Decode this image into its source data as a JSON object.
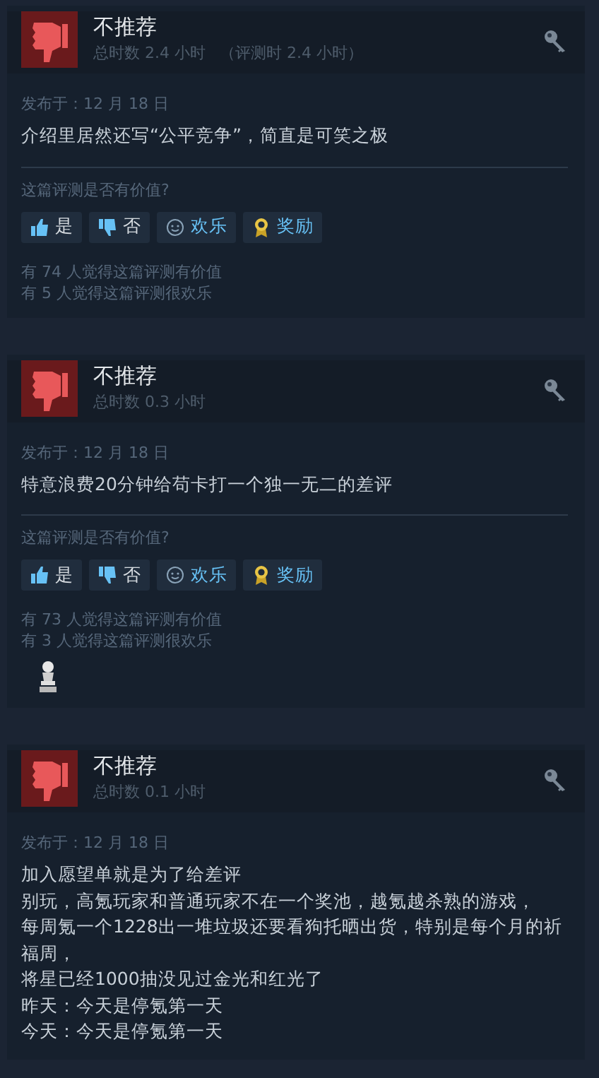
{
  "reviews": [
    {
      "verdict": "不推荐",
      "playtime": "总时数 2.4 小时",
      "playtime_at_review": "（评测时 2.4 小时）",
      "posted": "发布于：12 月 18 日",
      "body": [
        "介绍里居然还写“公平竞争”，简直是可笑之极"
      ],
      "question": "这篇评测是否有价值?",
      "buttons": [
        {
          "kind": "yes",
          "label": "是"
        },
        {
          "kind": "no",
          "label": "否"
        },
        {
          "kind": "funny",
          "label": "欢乐"
        },
        {
          "kind": "award",
          "label": "奖励"
        }
      ],
      "stats": [
        "有 74 人觉得这篇评测有价值",
        "有 5 人觉得这篇评测很欢乐"
      ]
    },
    {
      "verdict": "不推荐",
      "playtime": "总时数 0.3 小时",
      "posted": "发布于：12 月 18 日",
      "body": [
        "特意浪费20分钟给苟卡打一个独一无二的差评"
      ],
      "question": "这篇评测是否有价值?",
      "buttons": [
        {
          "kind": "yes",
          "label": "是"
        },
        {
          "kind": "no",
          "label": "否"
        },
        {
          "kind": "funny",
          "label": "欢乐"
        },
        {
          "kind": "award",
          "label": "奖励"
        }
      ],
      "stats": [
        "有 73 人觉得这篇评测有价值",
        "有 3 人觉得这篇评测很欢乐"
      ],
      "awards": [
        {
          "kind": "statue"
        }
      ]
    },
    {
      "verdict": "不推荐",
      "playtime": "总时数 0.1 小时",
      "posted": "发布于：12 月 18 日",
      "body": [
        "加入愿望单就是为了给差评",
        "别玩，高氪玩家和普通玩家不在一个奖池，越氪越杀熟的游戏，",
        "每周氪一个1228出一堆垃圾还要看狗托晒出货，特别是每个月的祈福周，",
        "将星已经1000抽没见过金光和红光了",
        "昨天：今天是停氪第一天",
        "今天：今天是停氪第一天"
      ]
    }
  ]
}
